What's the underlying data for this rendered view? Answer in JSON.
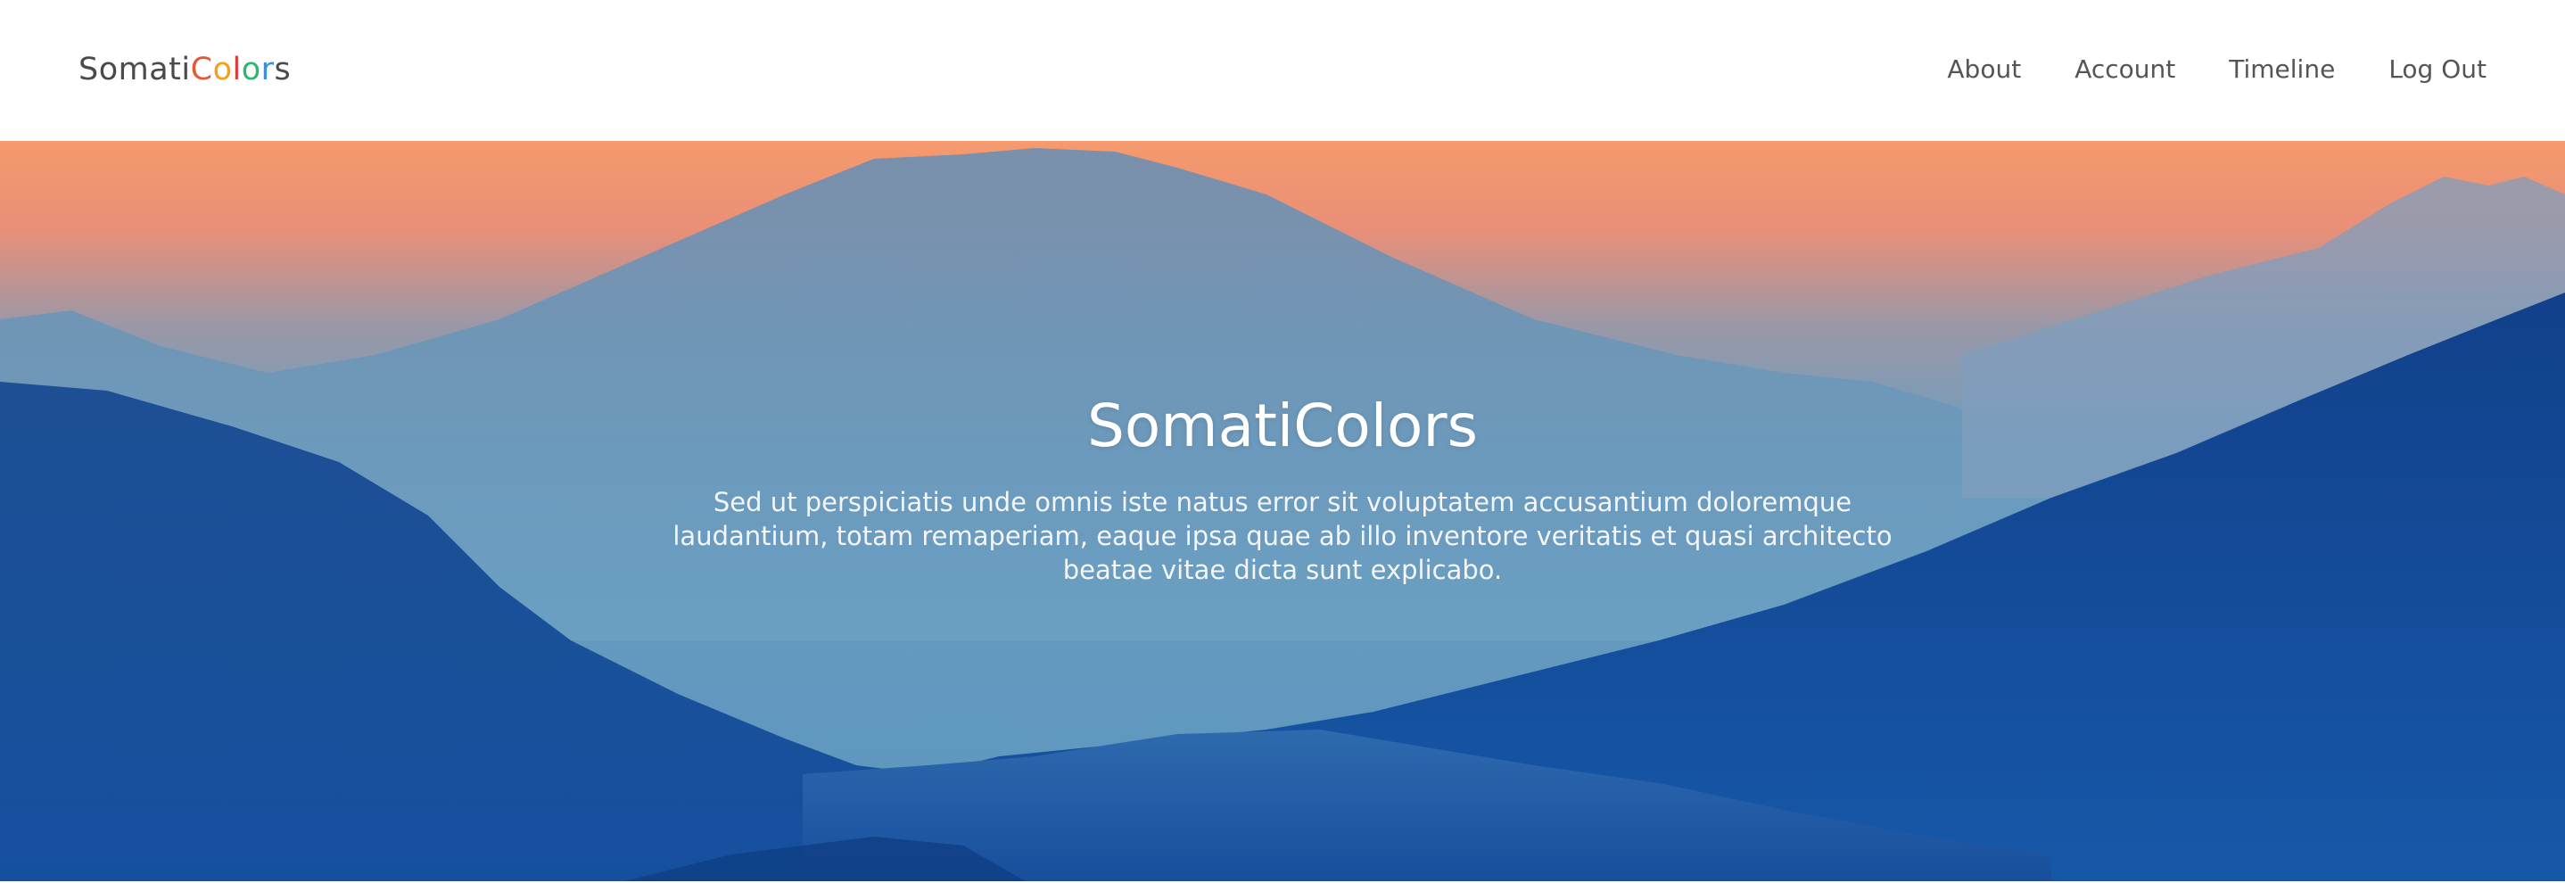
{
  "brand": {
    "parts": [
      {
        "text": "Somati",
        "color": "#4a4a4a"
      },
      {
        "text": "C",
        "color": "#e05a3a"
      },
      {
        "text": "o",
        "color": "#f4a01b"
      },
      {
        "text": "l",
        "color": "#e03b3b"
      },
      {
        "text": "o",
        "color": "#2bb673"
      },
      {
        "text": "r",
        "color": "#3b8fd6"
      },
      {
        "text": "s",
        "color": "#4a4a4a"
      }
    ]
  },
  "nav": {
    "items": [
      {
        "label": "About"
      },
      {
        "label": "Account"
      },
      {
        "label": "Timeline"
      },
      {
        "label": "Log Out"
      }
    ]
  },
  "hero": {
    "title": "SomatiColors",
    "text": "Sed ut perspiciatis unde omnis iste natus error sit voluptatem accusantium doloremque laudantium, totam remaperiam, eaque ipsa quae ab illo inventore veritatis et quasi architecto beatae vitae dicta sunt explicabo.",
    "image": "mountain-sunset-image"
  },
  "colors": {
    "sky_top": "#f49a6e",
    "sky_mid": "#8d95a9",
    "haze": "#6ea2c2",
    "mountain_far": "#5b8fb8",
    "mountain_mid": "#2f69ad",
    "mountain_near": "#1a4f9e"
  }
}
